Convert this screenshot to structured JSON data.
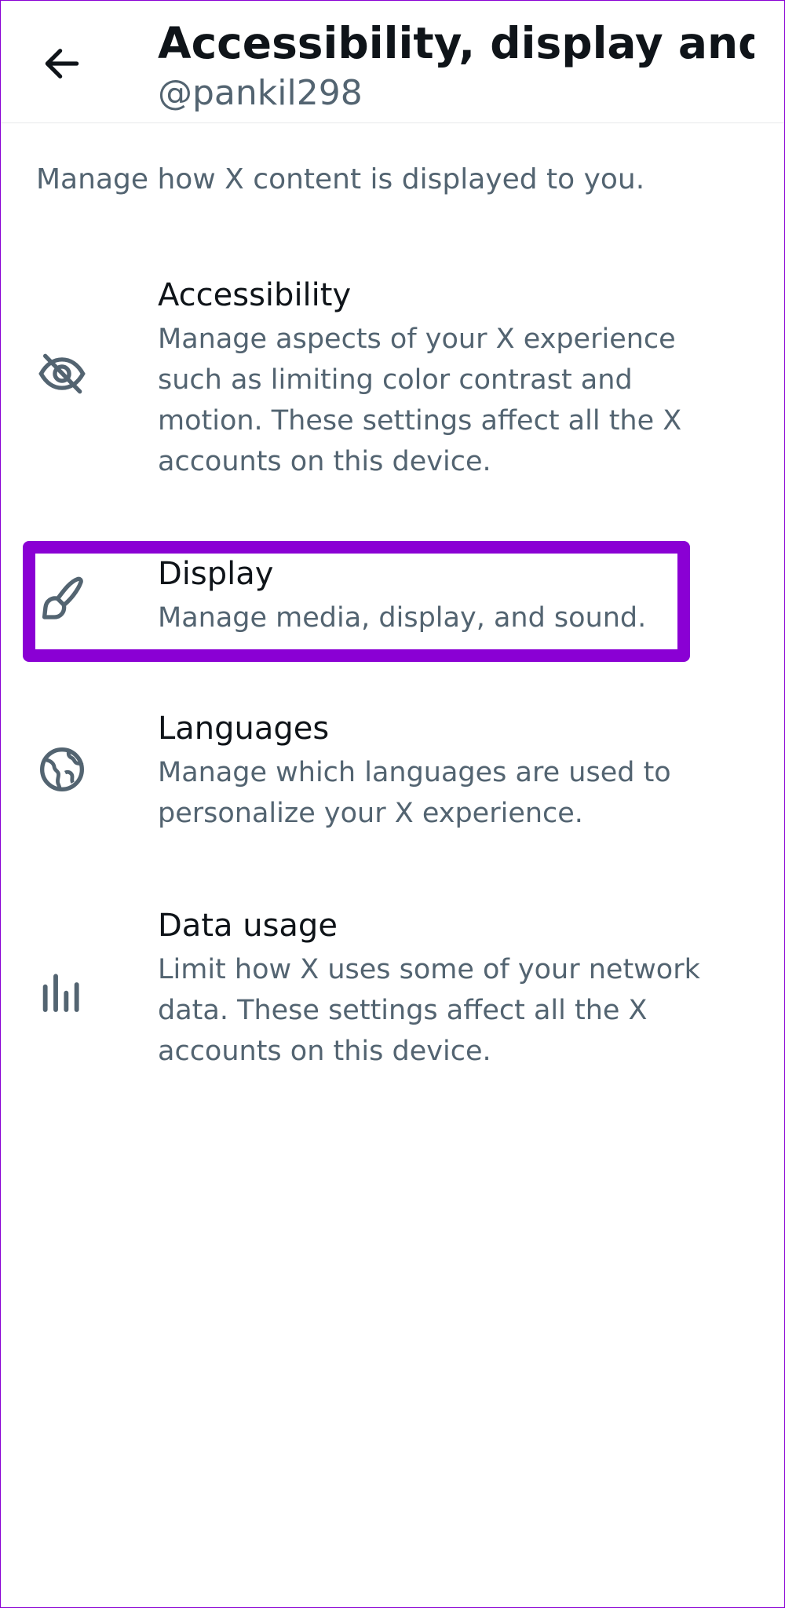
{
  "header": {
    "title": "Accessibility, display and l...",
    "handle": "@pankil298",
    "back_icon": "arrow-left-icon"
  },
  "intro_text": "Manage how X content is displayed to you.",
  "items": [
    {
      "title": "Accessibility",
      "description": "Manage aspects of your X experience such as limiting color contrast and motion. These settings affect all the X accounts on this device.",
      "icon": "eye-off-icon"
    },
    {
      "title": "Display",
      "description": "Manage media, display, and sound.",
      "icon": "brush-icon"
    },
    {
      "title": "Languages",
      "description": "Manage which languages are used to personalize your X experience.",
      "icon": "globe-icon"
    },
    {
      "title": "Data usage",
      "description": "Limit how X uses some of your network data. These settings affect all the X accounts on this device.",
      "icon": "bar-chart-icon"
    }
  ],
  "colors": {
    "highlight": "#8a00d4",
    "primary_text": "#0f1419",
    "secondary_text": "#536471",
    "icon": "#536471"
  }
}
